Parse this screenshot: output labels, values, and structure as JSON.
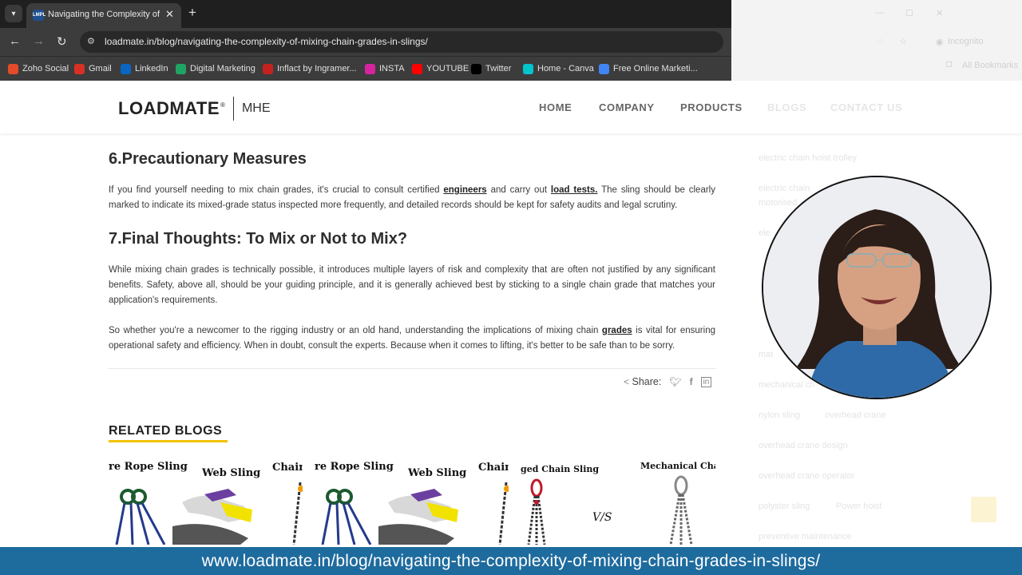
{
  "browser": {
    "tab_title": "Navigating the Complexity of M",
    "tab_favicon": "LMPL",
    "url": "loadmate.in/blog/navigating-the-complexity-of-mixing-chain-grades-in-slings/",
    "incognito_label": "Incognito",
    "all_bookmarks_label": "All Bookmarks",
    "bookmarks": [
      {
        "label": "Zoho Social",
        "icon": "zoho-icon",
        "color": "#e54b2b"
      },
      {
        "label": "Gmail",
        "icon": "gmail-icon",
        "color": "#d93025"
      },
      {
        "label": "LinkedIn",
        "icon": "linkedin-icon",
        "color": "#0a66c2"
      },
      {
        "label": "Digital Marketing",
        "icon": "sheets-icon",
        "color": "#1fa463"
      },
      {
        "label": "Inflact by Ingramer...",
        "icon": "inflact-icon",
        "color": "#c5221f"
      },
      {
        "label": "INSTA",
        "icon": "instagram-icon",
        "color": "#d6249f"
      },
      {
        "label": "YOUTUBE",
        "icon": "youtube-icon",
        "color": "#ff0000"
      },
      {
        "label": "Twitter",
        "icon": "x-icon",
        "color": "#000000"
      },
      {
        "label": "Home - Canva",
        "icon": "canva-icon",
        "color": "#00c4cc"
      },
      {
        "label": "Free Online Marketi...",
        "icon": "google-icon",
        "color": "#4285f4"
      }
    ]
  },
  "site": {
    "logo": "LOADMATE",
    "logo_reg": "®",
    "logo_sub": "MHE",
    "nav": [
      "HOME",
      "COMPANY",
      "PRODUCTS",
      "BLOGS",
      "CONTACT US"
    ]
  },
  "article": {
    "h6": "6.Precautionary Measures",
    "p6_a": "If you find yourself needing to mix chain grades, it's crucial to consult certified ",
    "p6_link1": "engineers",
    "p6_b": " and carry out ",
    "p6_link2": "load tests.",
    "p6_c": " The sling should be clearly marked to indicate its mixed-grade status inspected more frequently, and detailed records should be kept for safety audits and legal scrutiny.",
    "h7": "7.Final Thoughts: To Mix or Not to Mix?",
    "p7": "While mixing chain grades is technically possible, it introduces multiple layers of risk and complexity that are often not justified by any significant benefits. Safety, above all, should be your guiding principle, and it is generally achieved best by sticking to a single chain grade that matches your application's requirements.",
    "p8_a": "So whether you're a newcomer to the rigging industry or an old hand, understanding the implications of mixing chain ",
    "p8_link": "grades",
    "p8_b": " is vital for ensuring operational safety and efficiency. When in doubt, consult the experts. Because when it comes to lifting, it's better to be safe than to be sorry.",
    "share_label": "Share:"
  },
  "related": {
    "title": "RELATED BLOGS",
    "cards": [
      {
        "labels": [
          "re Rope Sling",
          "Web Sling",
          "Chain"
        ]
      },
      {
        "labels": [
          "re Rope Sling",
          "Web Sling",
          "Chain"
        ]
      },
      {
        "labels": [
          "ged Chain Sling",
          "V/S",
          "Mechanical Chain S"
        ]
      }
    ]
  },
  "sidebar_tags": [
    "electric chain hoist trolley",
    "electric chain",
    "motorised",
    "ele",
    "mat",
    "mechanical ch",
    "nylon sling",
    "overhead crane",
    "overhead crane design",
    "overhead crane operator",
    "polyster sling",
    "Power hoist",
    "preventive maintenance"
  ],
  "banner": {
    "text": "www.loadmate.in/blog/navigating-the-complexity-of-mixing-chain-grades-in-slings/"
  }
}
